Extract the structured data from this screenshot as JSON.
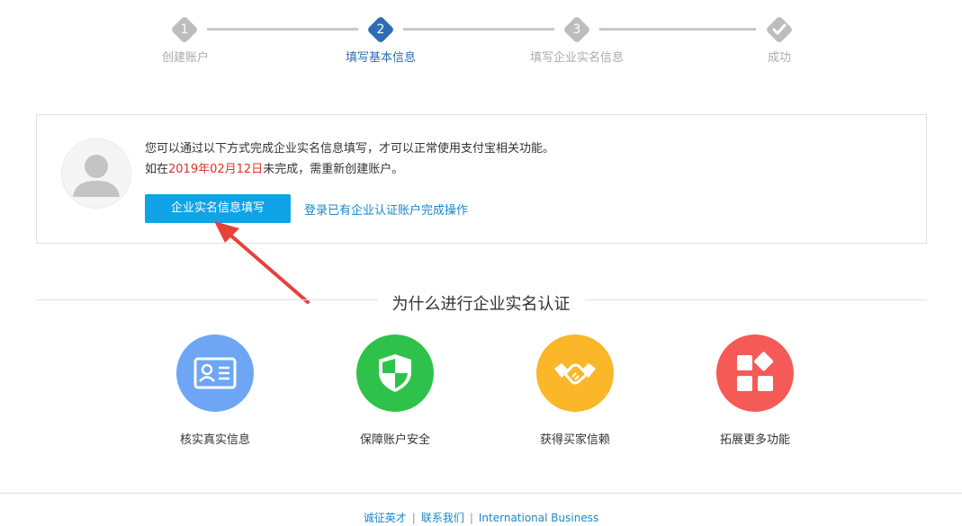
{
  "steps": [
    {
      "number": "1",
      "label": "创建账户",
      "state": "done"
    },
    {
      "number": "2",
      "label": "填写基本信息",
      "state": "active"
    },
    {
      "number": "3",
      "label": "填写企业实名信息",
      "state": "pending"
    },
    {
      "number": "",
      "label": "成功",
      "state": "pending"
    }
  ],
  "info": {
    "line1": "您可以通过以下方式完成企业实名信息填写，才可以正常使用支付宝相关功能。",
    "line2_prefix": "如在",
    "line2_date": "2019年02月12日",
    "line2_suffix": "未完成，需重新创建账户。",
    "primary_button": "企业实名信息填写",
    "login_link": "登录已有企业认证账户完成操作"
  },
  "why": {
    "title": "为什么进行企业实名认证",
    "features": [
      {
        "label": "核实真实信息",
        "icon": "id-card-icon",
        "color": "#6ea6f5"
      },
      {
        "label": "保障账户安全",
        "icon": "shield-icon",
        "color": "#2fc24a"
      },
      {
        "label": "获得买家信赖",
        "icon": "handshake-icon",
        "color": "#fbb62a"
      },
      {
        "label": "拓展更多功能",
        "icon": "apps-icon",
        "color": "#f55a56"
      }
    ]
  },
  "footer": {
    "links": [
      "诚征英才",
      "联系我们",
      "International Business"
    ]
  },
  "colors": {
    "accent_blue": "#2d6db5",
    "button_blue": "#11a3e8",
    "link_blue": "#1a87c9",
    "date_red": "#e0302a",
    "arrow_red": "#e8413a"
  }
}
